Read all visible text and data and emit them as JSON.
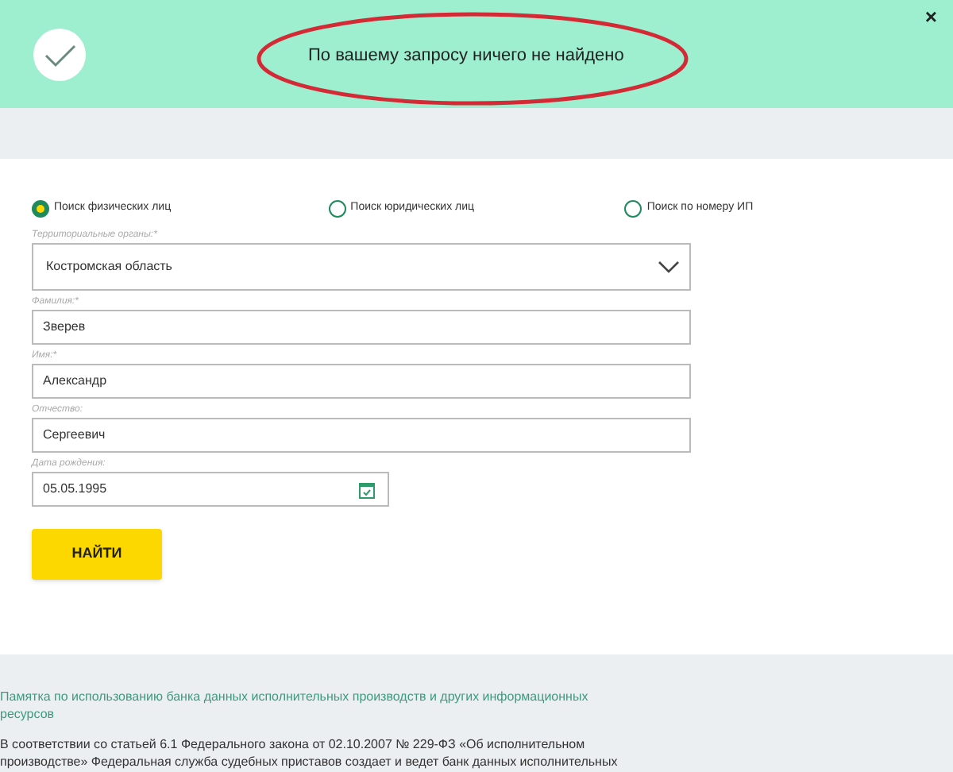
{
  "banner": {
    "message": "По вашему запросу ничего не найдено",
    "close": "×"
  },
  "search_types": [
    {
      "label": "Поиск физических лиц",
      "selected": true
    },
    {
      "label": "Поиск юридических лиц",
      "selected": false
    },
    {
      "label": "Поиск по номеру ИП",
      "selected": false
    }
  ],
  "fields": [
    {
      "kind": "select",
      "label": "Территориальные органы:*",
      "value": "Костромская область"
    },
    {
      "kind": "text",
      "label": "Фамилия:*",
      "value": "Зверев"
    },
    {
      "kind": "text",
      "label": "Имя:*",
      "value": "Александр"
    },
    {
      "kind": "text",
      "label": "Отчество:",
      "value": "Сергеевич"
    },
    {
      "kind": "date",
      "label": "Дата рождения:",
      "value": "05.05.1995"
    }
  ],
  "submit_button": "НАЙТИ",
  "footer": {
    "link": "Памятка по использованию банка данных исполнительных производств и других информационных ресурсов",
    "text": "В соответствии со статьей 6.1 Федерального закона от 02.10.2007 № 229-ФЗ «Об исполнительном производстве» Федеральная служба судебных приставов создает и ведет банк данных исполнительных"
  }
}
